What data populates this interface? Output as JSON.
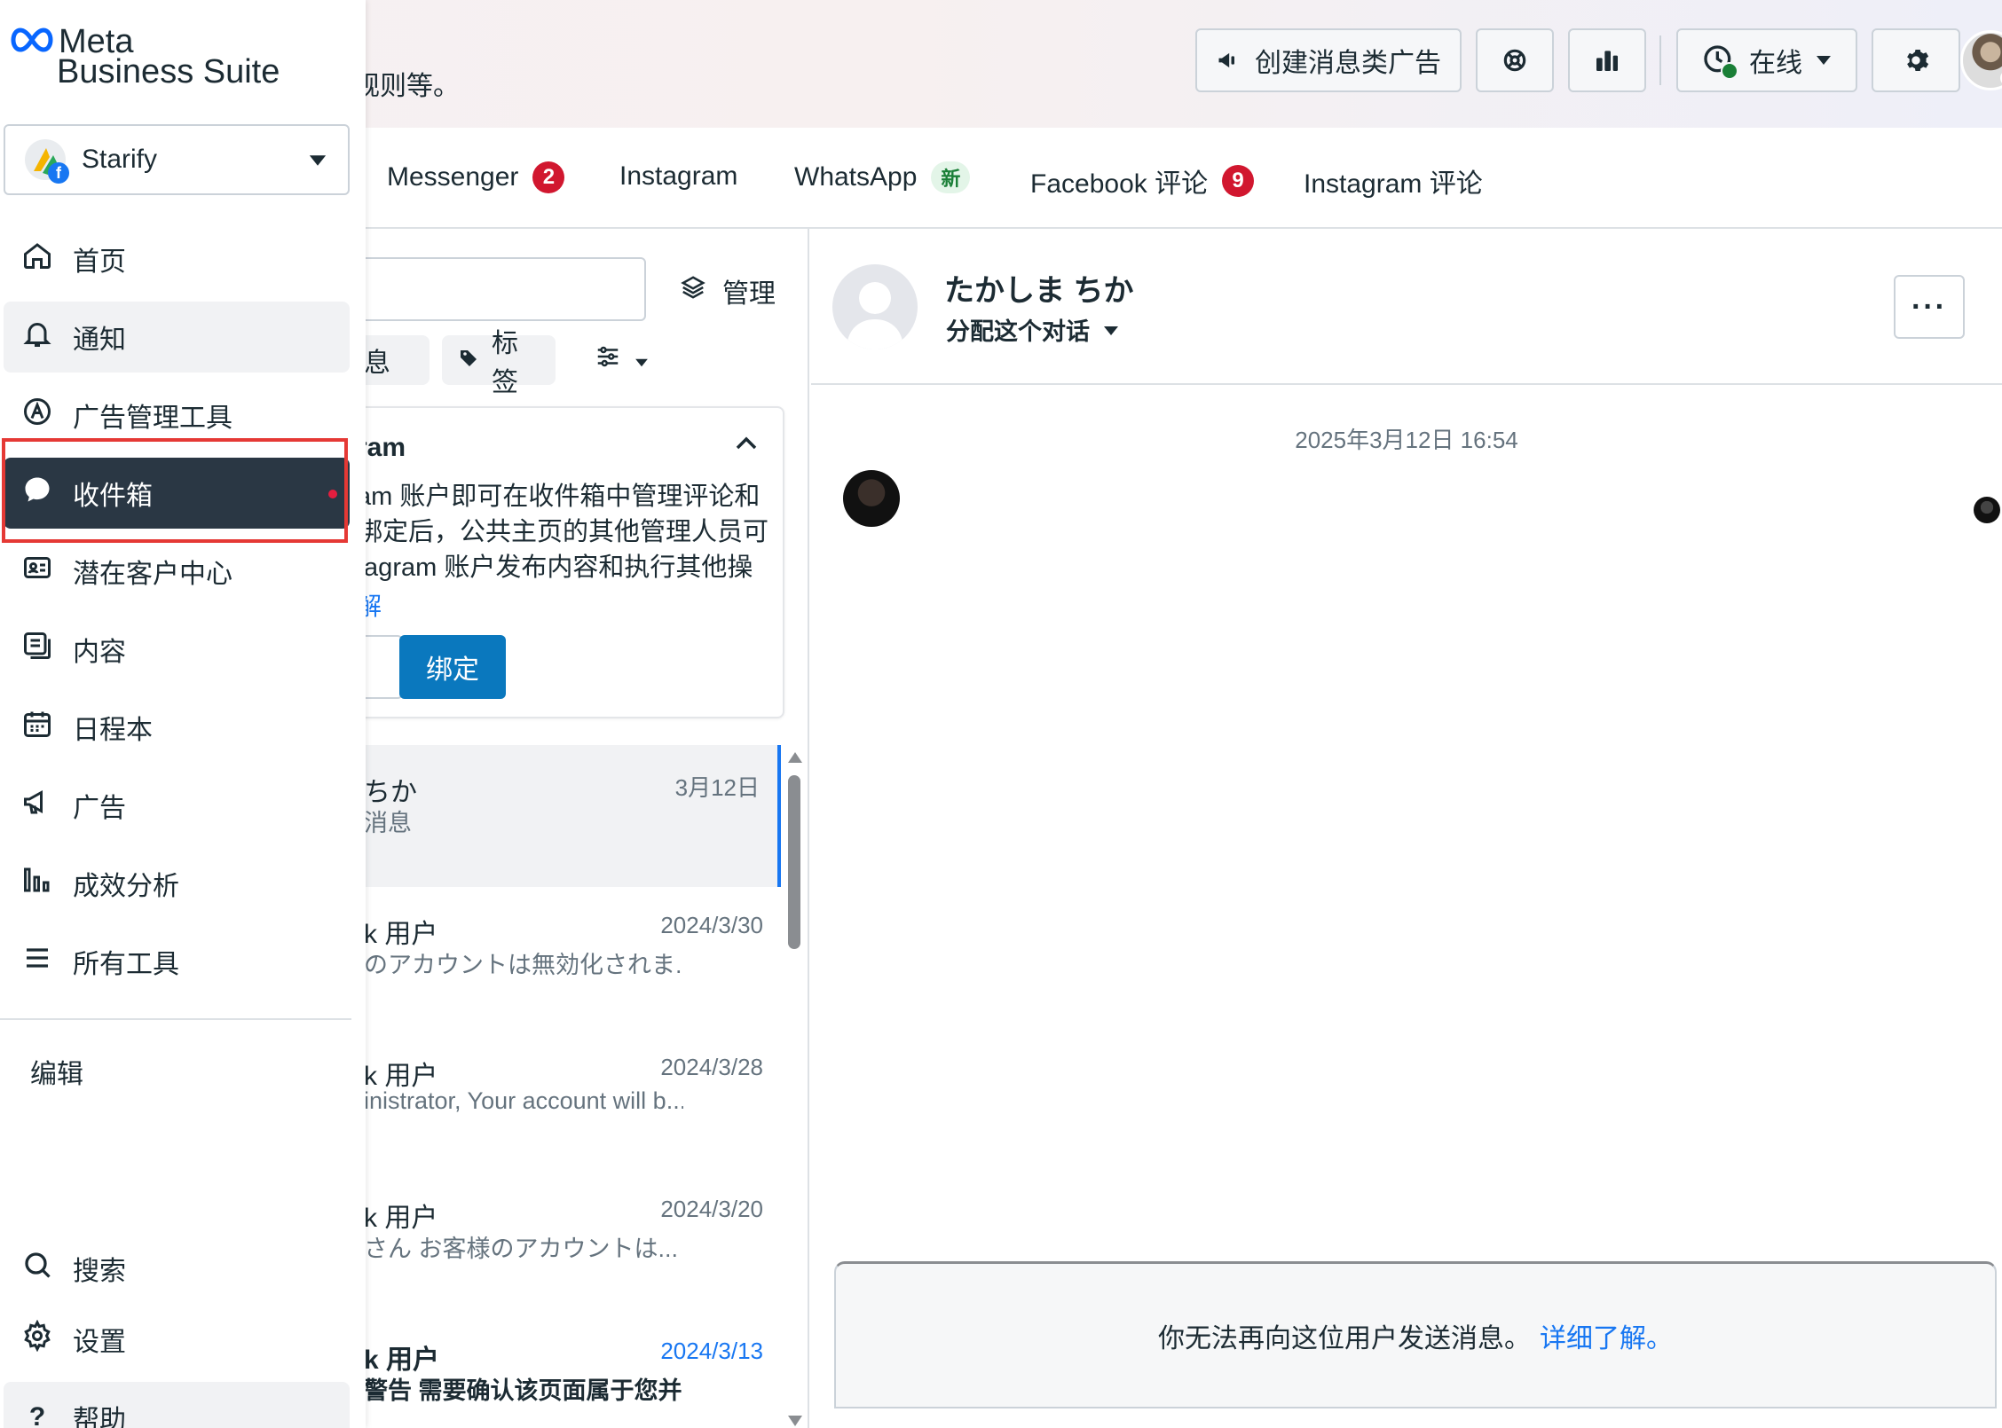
{
  "header": {
    "subtext": "规则等。",
    "create_ad_label": "创建消息类广告",
    "status_label": "在线",
    "icons": [
      "megaphone-icon",
      "integrations-icon",
      "insights-icon",
      "clock-status-icon",
      "gear-icon"
    ]
  },
  "tabs": [
    {
      "label": "Messenger",
      "badge": "2"
    },
    {
      "label": "Instagram"
    },
    {
      "label": "WhatsApp",
      "badge_new": "新"
    },
    {
      "label": "Facebook 评论",
      "badge": "9"
    },
    {
      "label": "Instagram 评论"
    }
  ],
  "list": {
    "manage_label": "管理",
    "chips": {
      "messages": "消息",
      "labels": "标签"
    },
    "promo": {
      "title": "ram",
      "body": "am 账户即可在收件箱中管理评论和\n绑定后，公共主页的其他管理人员可\ntagram 账户发布内容和执行其他操",
      "link": "解",
      "bind_label": "绑定"
    },
    "conversations": [
      {
        "name": "ちか",
        "preview": "消息",
        "date": "3月12日"
      },
      {
        "name": "k 用户",
        "preview": "のアカウントは無効化されま...",
        "date": "2024/3/30"
      },
      {
        "name": "k 用户",
        "preview": "inistrator, Your account will b...",
        "date": "2024/3/28"
      },
      {
        "name": "k 用户",
        "preview": "さん お客様のアカウントは...",
        "date": "2024/3/20"
      },
      {
        "name": "k 用户",
        "preview": "警告 需要确认该页面属于您并...",
        "date": "2024/3/13"
      }
    ]
  },
  "chat": {
    "name": "たかしま ちか",
    "assign_label": "分配这个对话",
    "more_label": "···",
    "timestamp": "2025年3月12日 16:54",
    "notice_text": "你无法再向这位用户发送消息。",
    "notice_link": "详细了解。"
  },
  "sidebar": {
    "brand_line1": "Meta",
    "brand_line2": "Business Suite",
    "account_name": "Starify",
    "items": [
      {
        "label": "首页",
        "icon": "home-icon"
      },
      {
        "label": "通知",
        "icon": "bell-icon"
      },
      {
        "label": "广告管理工具",
        "icon": "ads-manager-icon"
      },
      {
        "label": "收件箱",
        "icon": "chat-bubble-icon"
      },
      {
        "label": "潜在客户中心",
        "icon": "contact-card-icon"
      },
      {
        "label": "内容",
        "icon": "content-icon"
      },
      {
        "label": "日程本",
        "icon": "calendar-icon"
      },
      {
        "label": "广告",
        "icon": "megaphone-icon"
      },
      {
        "label": "成效分析",
        "icon": "bar-chart-icon"
      },
      {
        "label": "所有工具",
        "icon": "menu-icon"
      }
    ],
    "edit_label": "编辑",
    "bottom_items": [
      {
        "label": "搜索",
        "icon": "search-icon"
      },
      {
        "label": "设置",
        "icon": "gear-icon"
      },
      {
        "label": "帮助",
        "icon": "help-icon"
      }
    ]
  },
  "colors": {
    "accent": "#1877f2",
    "badge": "#d1172f",
    "active_nav": "#2a3744",
    "highlight": "#e53935"
  }
}
